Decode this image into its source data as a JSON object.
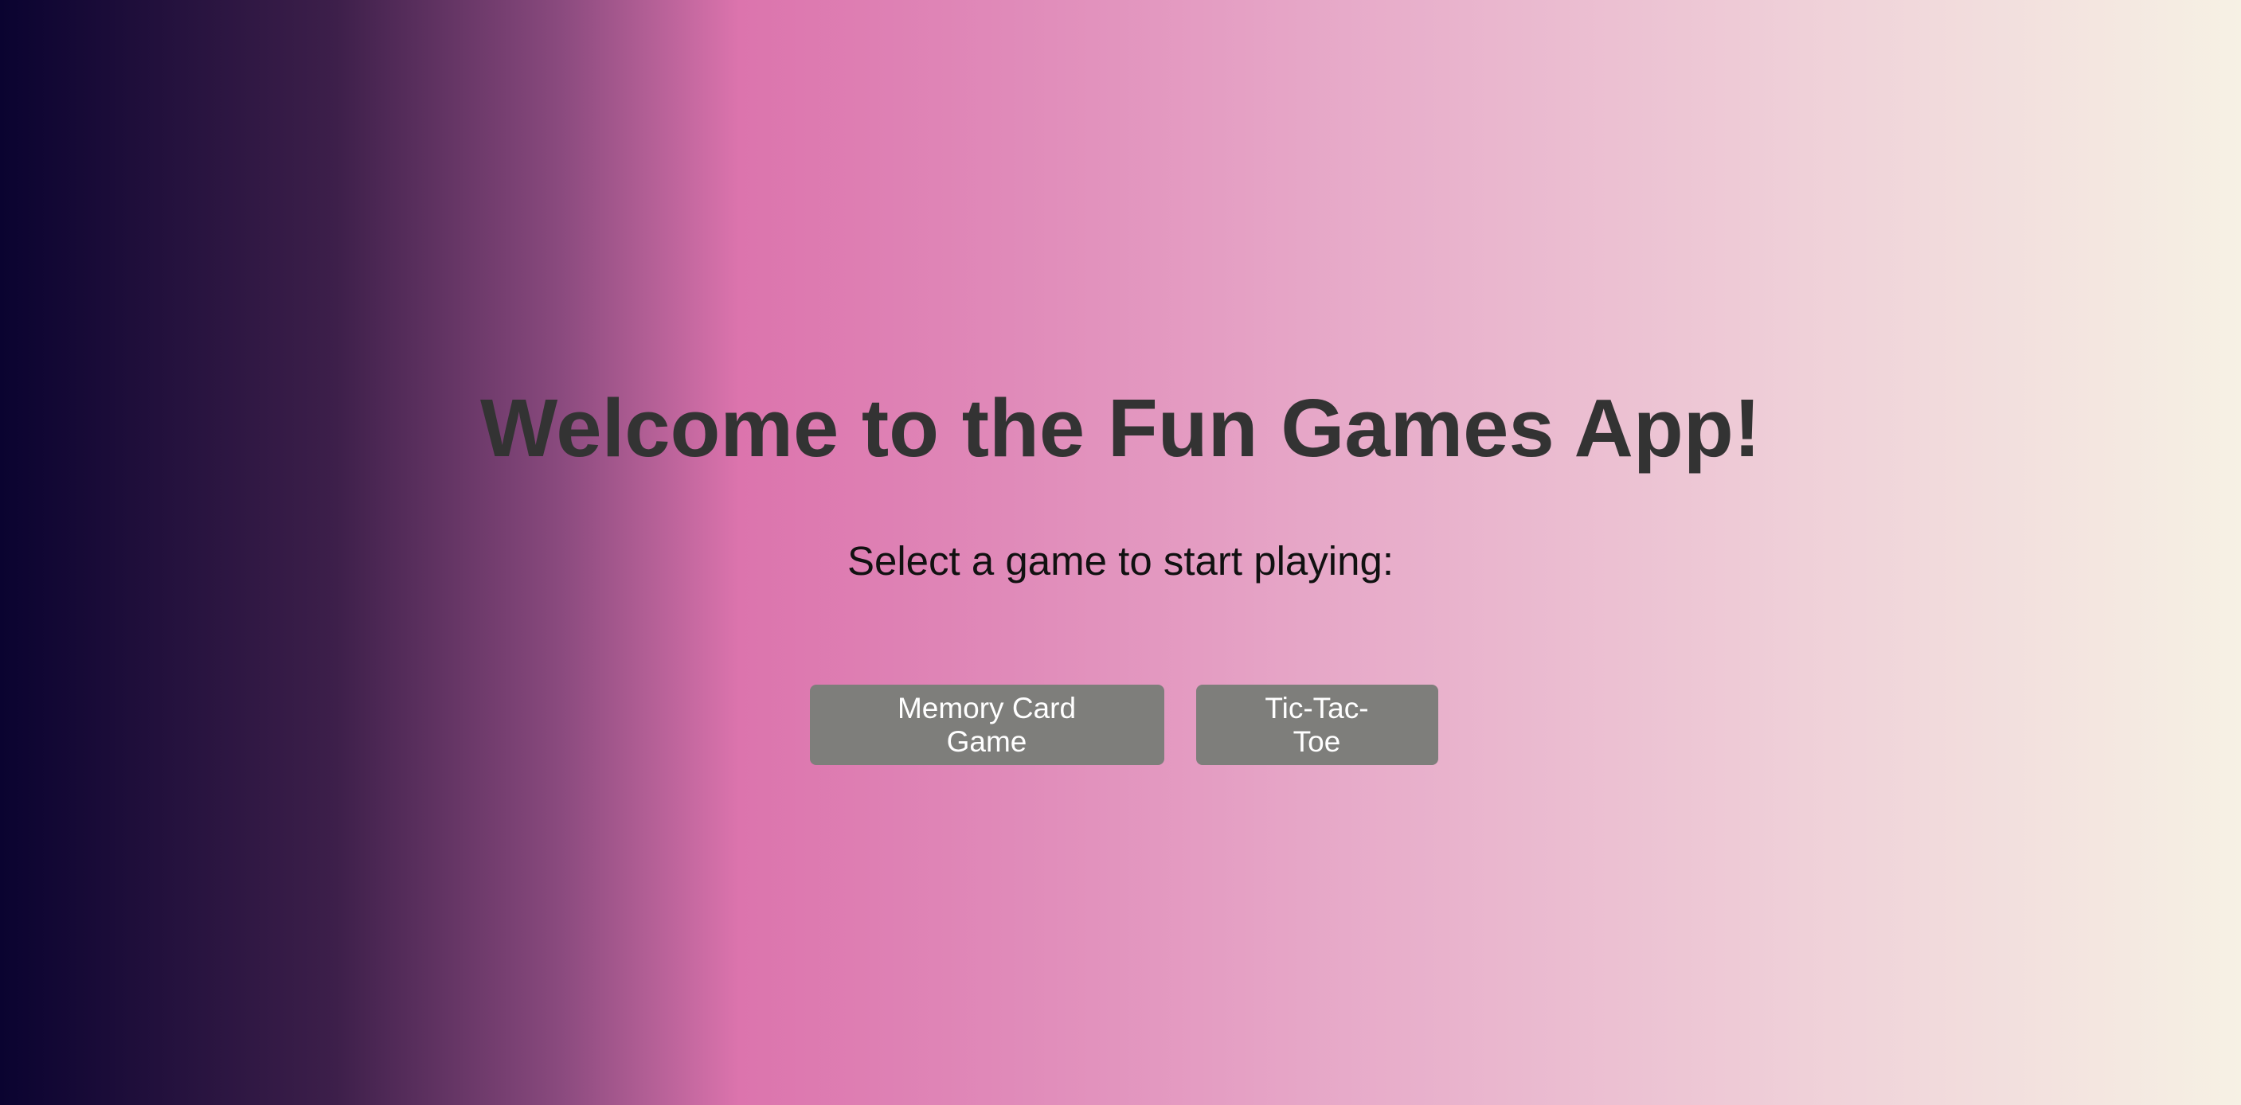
{
  "page": {
    "title": "Welcome to the Fun Games App!",
    "subtitle": "Select a game to start playing:"
  },
  "games": {
    "memory_label": "Memory Card Game",
    "tictactoe_label": "Tic-Tac-Toe"
  },
  "colors": {
    "button_bg": "#7e7e7b",
    "title_text": "#333333",
    "gradient_start": "#0a0330",
    "gradient_mid": "#dc74ad",
    "gradient_end": "#f6f1e4"
  }
}
